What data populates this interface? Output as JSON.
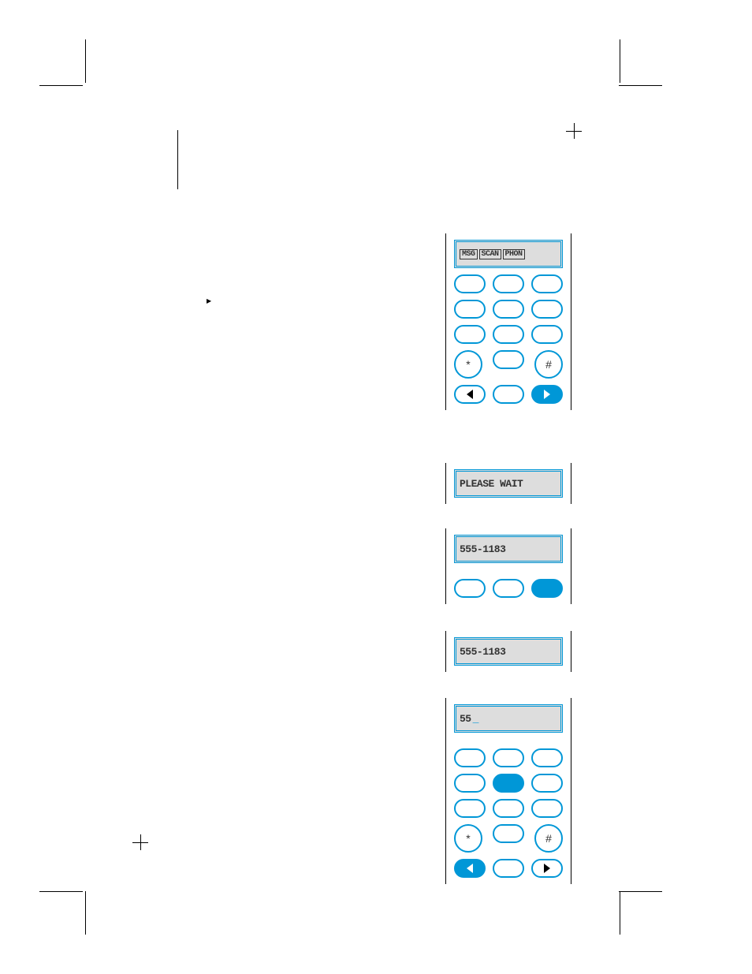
{
  "a": {
    "lcd_boxes": [
      "MSG",
      "SCAN",
      "PHON"
    ],
    "keys": {
      "r1": [
        "",
        "",
        ""
      ],
      "r2": [
        "",
        "",
        ""
      ],
      "r3": [
        "",
        "",
        ""
      ],
      "r4": [
        "*",
        "",
        "#"
      ]
    }
  },
  "b": {
    "lcd": "PLEASE WAIT"
  },
  "c": {
    "lcd": "555-1183"
  },
  "d": {
    "lcd": "555-1183"
  },
  "e": {
    "lcd_text": "55",
    "lcd_cursor": "_",
    "keys": {
      "r1": [
        "",
        "",
        ""
      ],
      "r2": [
        "",
        "",
        ""
      ],
      "r3": [
        "",
        "",
        ""
      ],
      "r4": [
        "*",
        "",
        "#"
      ]
    }
  },
  "play_glyph": "▶"
}
